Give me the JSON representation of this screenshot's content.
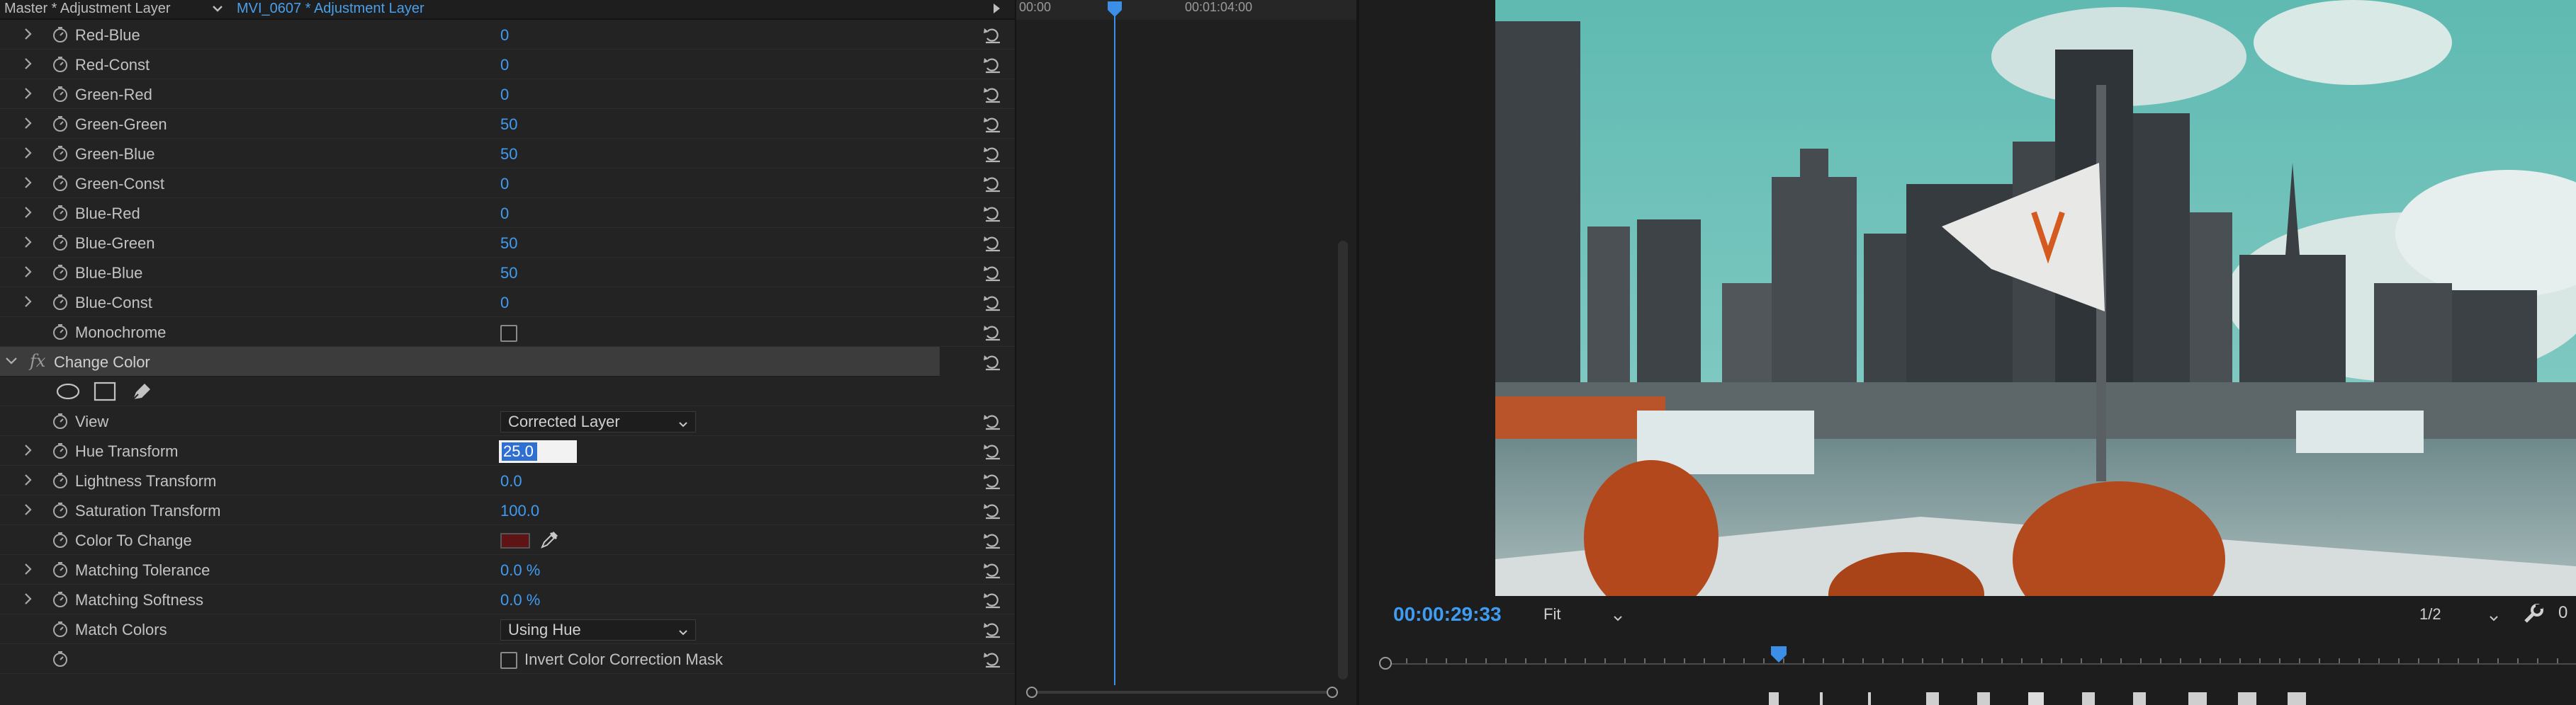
{
  "effect_controls": {
    "tab_master": "Master * Adjustment Layer",
    "tab_clip": "MVI_0607 * Adjustment Layer",
    "rows": [
      {
        "label": "Red-Blue",
        "value": "0"
      },
      {
        "label": "Red-Const",
        "value": "0"
      },
      {
        "label": "Green-Red",
        "value": "0"
      },
      {
        "label": "Green-Green",
        "value": "50"
      },
      {
        "label": "Green-Blue",
        "value": "50"
      },
      {
        "label": "Green-Const",
        "value": "0"
      },
      {
        "label": "Blue-Red",
        "value": "0"
      },
      {
        "label": "Blue-Green",
        "value": "50"
      },
      {
        "label": "Blue-Blue",
        "value": "50"
      },
      {
        "label": "Blue-Const",
        "value": "0"
      }
    ],
    "monochrome_label": "Monochrome",
    "monochrome_checked": false,
    "effect_badge": "fx",
    "effect_name": "Change Color",
    "view": {
      "label": "View",
      "selected": "Corrected Layer"
    },
    "hue_transform": {
      "label": "Hue Transform",
      "value": "25.0"
    },
    "lightness_transform": {
      "label": "Lightness Transform",
      "value": "0.0"
    },
    "saturation_transform": {
      "label": "Saturation Transform",
      "value": "100.0"
    },
    "color_to_change": {
      "label": "Color To Change",
      "color": "#5e1414"
    },
    "matching_tolerance": {
      "label": "Matching Tolerance",
      "value": "0.0 %"
    },
    "matching_softness": {
      "label": "Matching Softness",
      "value": "0.0 %"
    },
    "match_colors": {
      "label": "Match Colors",
      "selected": "Using Hue"
    },
    "invert_mask": {
      "label": "Invert Color Correction Mask",
      "checked": false
    }
  },
  "timeline_strip": {
    "ruler_start": "00:00",
    "ruler_mark": "00:01:04:00",
    "playhead_color": "#3b8fe6"
  },
  "program_monitor": {
    "timecode": "00:00:29:33",
    "zoom": "Fit",
    "resolution": "1/2",
    "overflow_text": "0",
    "accent_color": "#3f9cf2"
  }
}
